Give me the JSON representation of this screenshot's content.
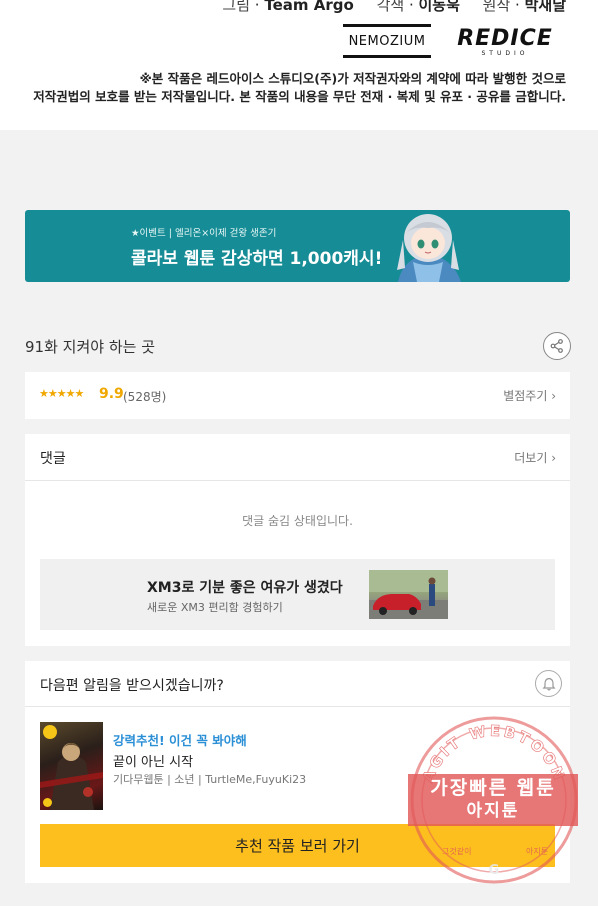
{
  "credits": {
    "art_label": "그림",
    "art_value": "Team Argo",
    "adapt_label": "각색",
    "adapt_value": "이동욱",
    "original_label": "원작",
    "original_value": "박새날",
    "logo_left": "NEMOZIUM",
    "logo_right": "REDICE",
    "logo_right_sub": "STUDIO",
    "notice_line1": "※본 작품은 레드아이스 스튜디오(주)가 저작권자와의 계약에 따라 발행한 것으로",
    "notice_line2": "저작권법의 보호를 받는 저작물입니다. 본 작품의 내용을 무단 전재 · 복제 및 유포 · 공유를 금합니다."
  },
  "banner": {
    "tag": "★이벤트 | 엘리온×이제 걷왕 생존기",
    "headline": "콜라보 웹툰 감상하면 1,000캐시!"
  },
  "episode": {
    "title": "91화 지켜야 하는 곳",
    "share_icon": "share-icon"
  },
  "rating": {
    "stars": "★★★★★",
    "score": "9.9",
    "count": "(528명)",
    "rate_button": "별점주기 ›"
  },
  "comments": {
    "header": "댓글",
    "more": "더보기 ›",
    "hidden_message": "댓글 숨김 상태입니다."
  },
  "ad": {
    "title": "XM3로 기분 좋은 여유가 생겼다",
    "subtitle": "새로운 XM3 편리함 경험하기"
  },
  "notify": {
    "header": "다음편 알림을 받으시겠습니까?",
    "bell_icon": "bell-icon",
    "recommendation": {
      "tag": "강력추천! 이건 꼭 봐야해",
      "title": "끝이 아닌 시작",
      "meta": "기다무웹툰 | 소년 | TurtleMe,FuyuKi23"
    },
    "cta": "추천 작품 보러 가기"
  },
  "watermark": {
    "ring_text": "AGIT WEBTOON",
    "line1": "가장빠른 웹툰",
    "line2": "아지툰",
    "small_left": "그것같이",
    "small_right": "아지툰"
  },
  "colors": {
    "banner_bg": "#168d96",
    "star": "#f0a800",
    "link_blue": "#2b8fd6",
    "cta_yellow": "#fcbf1e",
    "watermark_red": "#e25858"
  }
}
